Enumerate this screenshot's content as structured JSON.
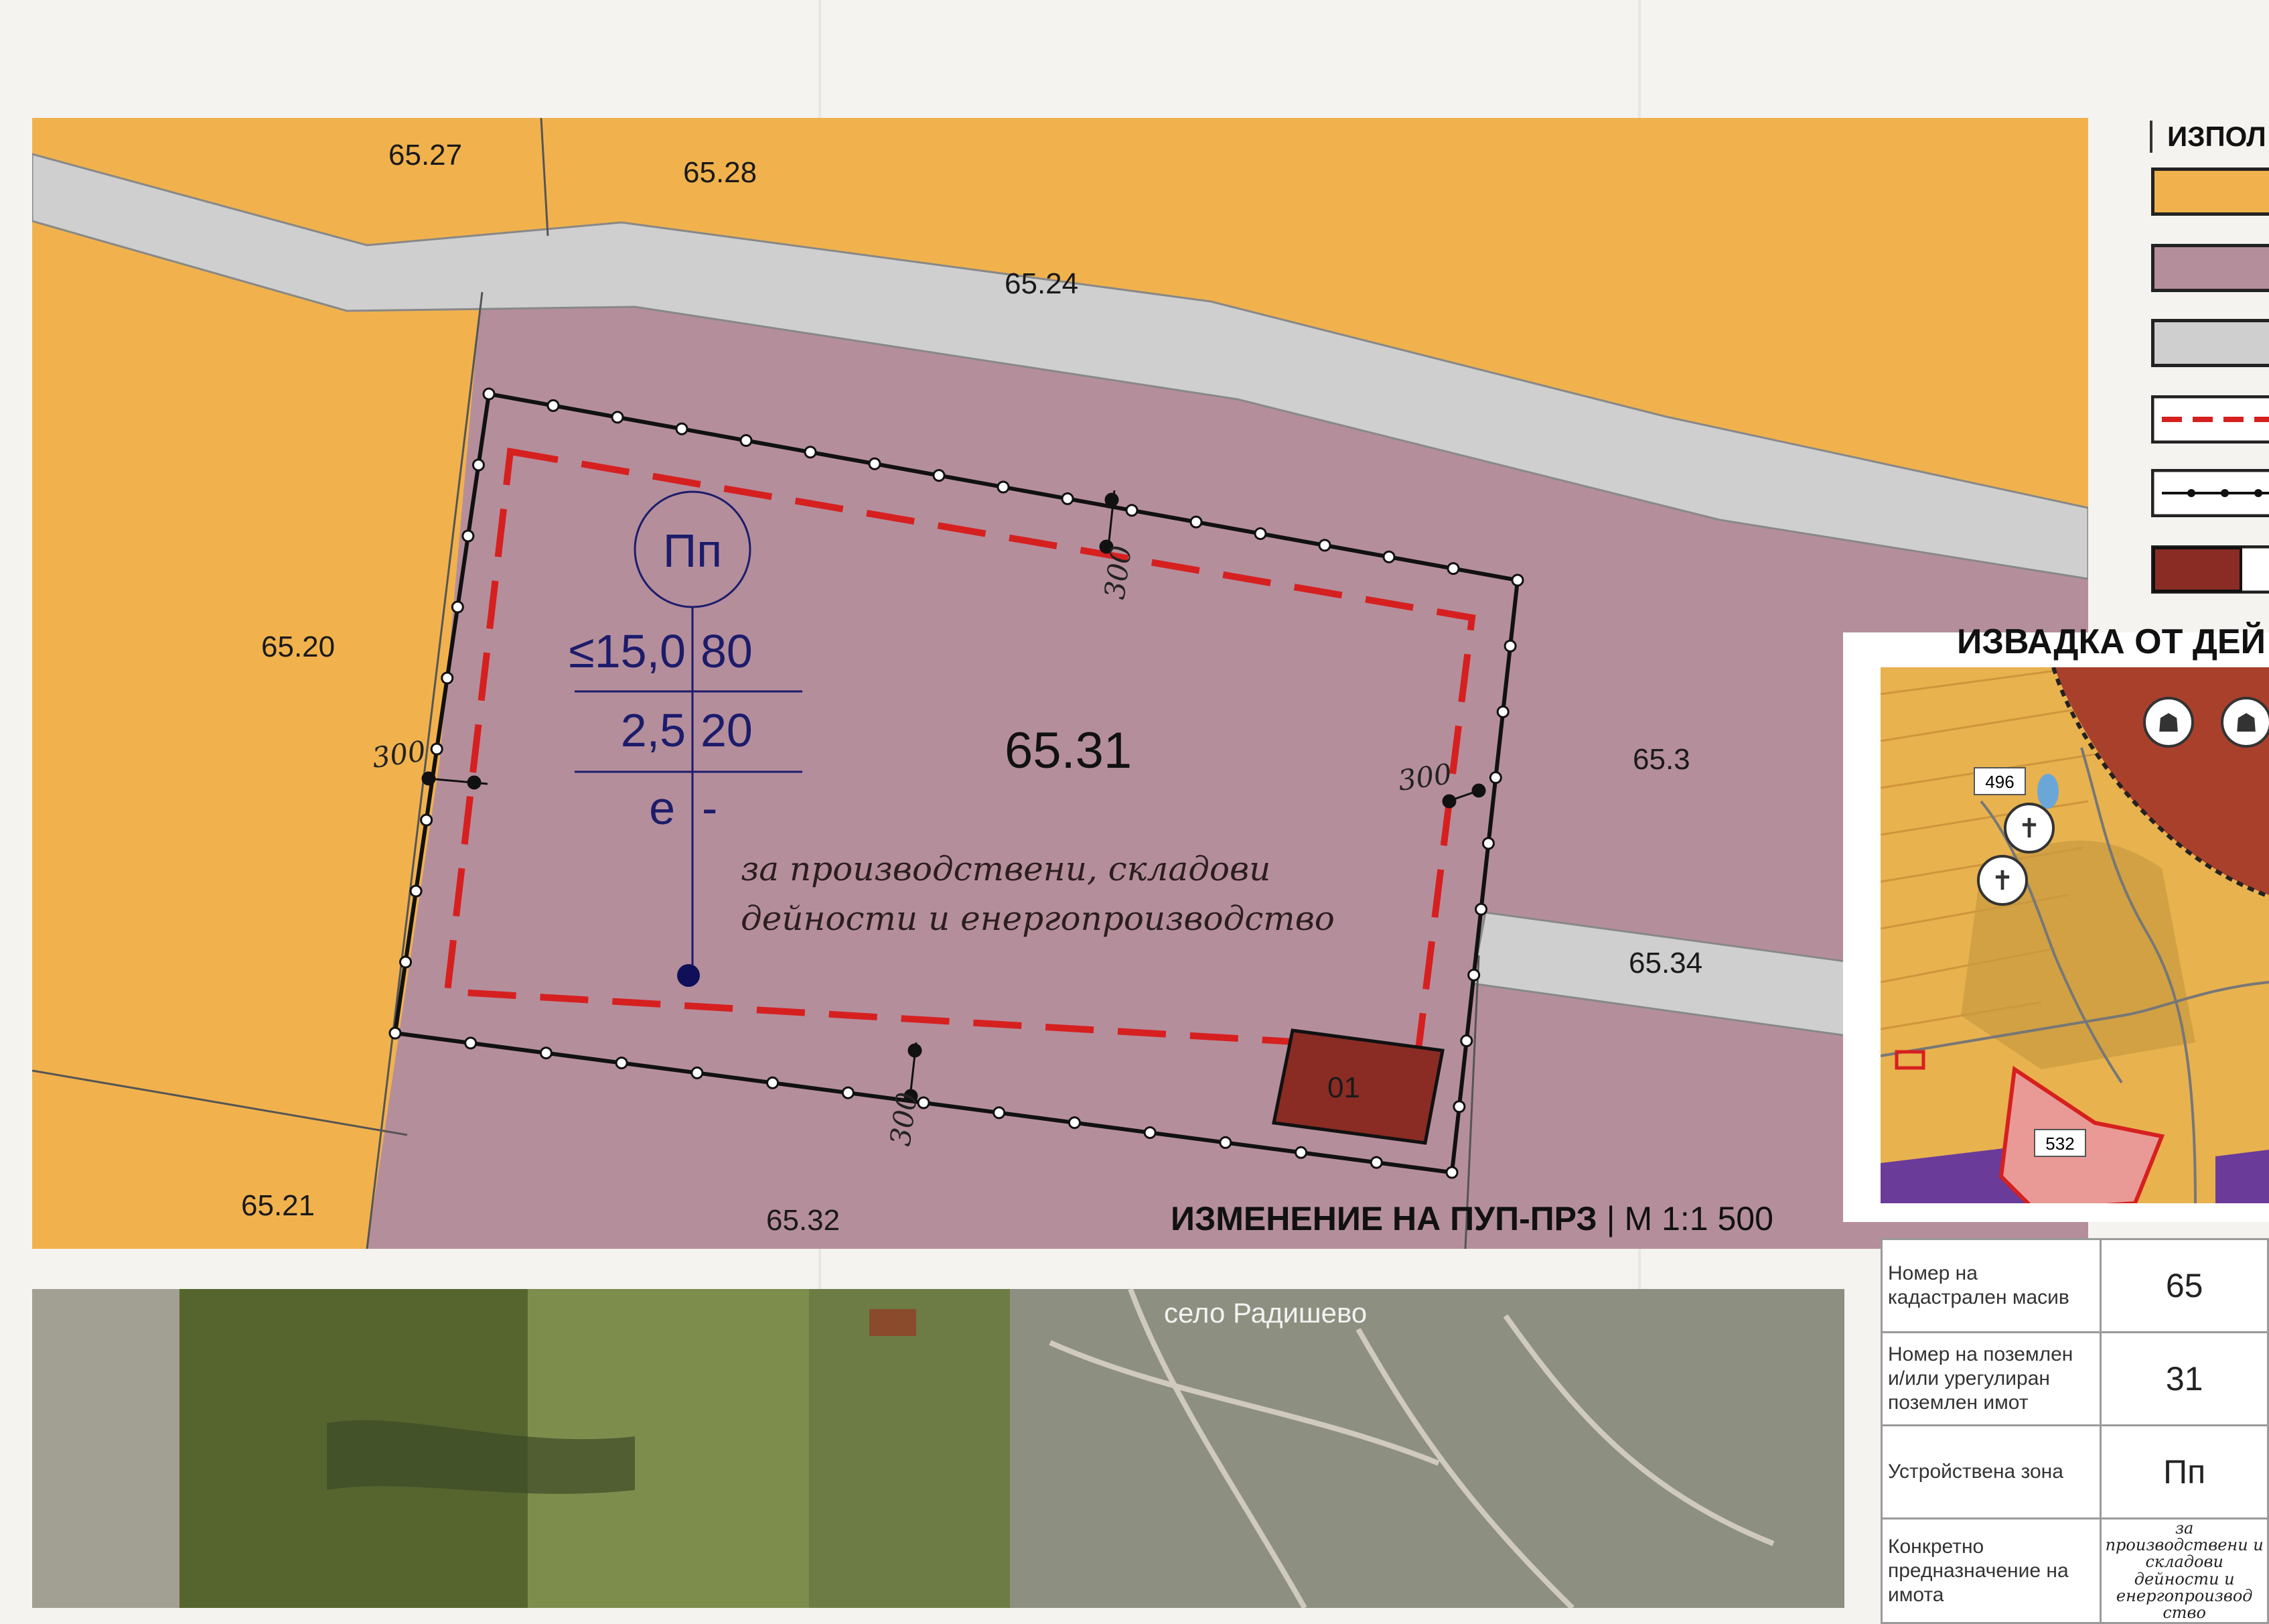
{
  "main_map": {
    "plots": [
      {
        "id": "65.27"
      },
      {
        "id": "65.28"
      },
      {
        "id": "65.24"
      },
      {
        "id": "65.20"
      },
      {
        "id": "65.3"
      },
      {
        "id": "65.34"
      },
      {
        "id": "65.21"
      },
      {
        "id": "65.32"
      }
    ],
    "main_plot": "65.31",
    "dimension_label": "300",
    "building_label": "01",
    "zone": {
      "code": "Пп",
      "max_height": "≤15,0",
      "density": "80",
      "intensity": "2,5",
      "green": "20",
      "e": "е",
      "dash": "-"
    },
    "purpose_line1": "за производствени, складови",
    "purpose_line2": "дейности и енергопроизводство",
    "title_bold": "ИЗМЕНЕНИЕ НА ПУП-ПРЗ",
    "title_sep": "|",
    "title_scale": "М 1:1 500"
  },
  "legend": {
    "header": "ИЗПОЛ",
    "colors": {
      "residential": "#f1b24d",
      "production": "#b58e9c",
      "road": "#cfcfcf",
      "building": "#8a2c24"
    }
  },
  "extract": {
    "title": "ИЗВАДКА ОТ ДЕЙ",
    "labels": [
      "496",
      "532"
    ]
  },
  "info_table": [
    {
      "label": "Номер на кадастрален масив",
      "value": "65"
    },
    {
      "label": "Номер на поземлен и/или урегулиран поземлен имот",
      "value": "31"
    },
    {
      "label": "Устройствена зона",
      "value": "Пп"
    },
    {
      "label": "Конкретно предназначение на имота",
      "value": "за производствени и складови дейности и енергопроизвод ство"
    }
  ],
  "photo": {
    "village": "село Радишево"
  }
}
